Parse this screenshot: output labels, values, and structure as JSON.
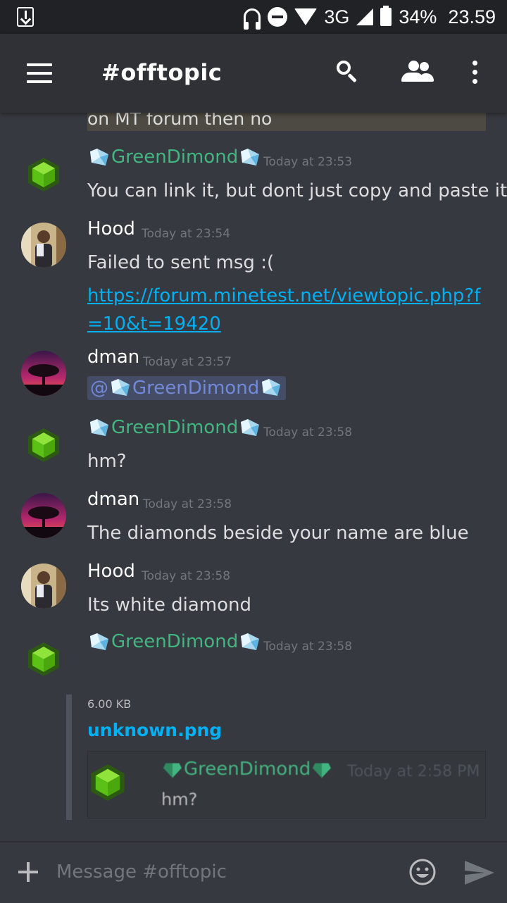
{
  "status_bar": {
    "network": "3G",
    "battery": "34%",
    "time": "23.59",
    "colors": {
      "bg": "#202225"
    }
  },
  "toolbar": {
    "channel_title": "#offtopic",
    "icons": [
      "hamburger-menu-icon",
      "search-icon",
      "members-icon",
      "more-vertical-icon"
    ]
  },
  "messages": {
    "previous_embed_text": "on MT forum then no",
    "items": [
      {
        "author": "GreenDimond",
        "timestamp": "Today at 23:53",
        "body": "You can link it, but dont just copy and paste it."
      },
      {
        "author": "Hood",
        "timestamp": "Today at 23:54",
        "body": "Failed to sent msg :(",
        "link": "https://forum.minetest.net/viewtopic.php?f=10&t=19420"
      },
      {
        "author": "dman",
        "timestamp": "Today at 23:57",
        "mention_at": "@",
        "mention_name": "GreenDimond"
      },
      {
        "author": "GreenDimond",
        "timestamp": "Today at 23:58",
        "body": "hm?"
      },
      {
        "author": "dman",
        "timestamp": "Today at 23:58",
        "body": "The diamonds beside your name are blue"
      },
      {
        "author": "Hood",
        "timestamp": "Today at 23:58",
        "body": "Its white diamond"
      },
      {
        "author": "GreenDimond",
        "timestamp": "Today at 23:58",
        "attachment": {
          "size": "6.00 KB",
          "filename": "unknown.png",
          "preview": {
            "author": "GreenDimond",
            "timestamp": "Today at 2:58 PM",
            "body": "hm?"
          }
        }
      }
    ]
  },
  "composer": {
    "placeholder": "Message #offtopic"
  },
  "colors": {
    "background": "#36393f",
    "toolbar": "#2f3136",
    "green_role": "#43b581",
    "link": "#00b0f4",
    "mention": "#7289da",
    "timestamp": "#72767d"
  }
}
